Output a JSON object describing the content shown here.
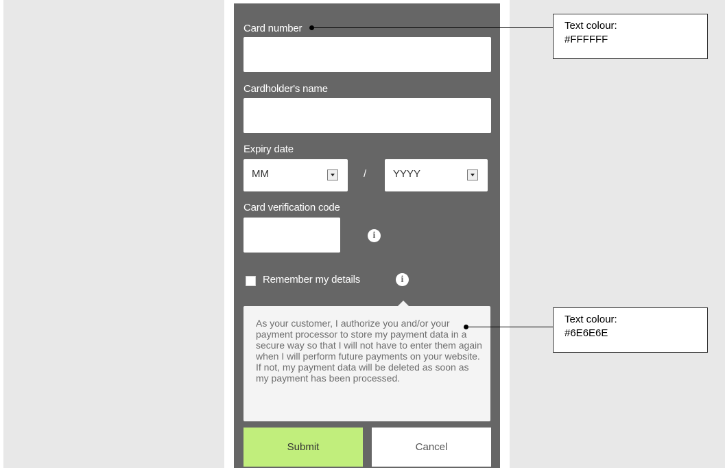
{
  "form": {
    "card_number_label": "Card number",
    "cardholder_label": "Cardholder's name",
    "expiry_label": "Expiry date",
    "month_value": "MM",
    "year_value": "YYYY",
    "slash": "/",
    "cvc_label": "Card verification code",
    "remember_label": "Remember my details",
    "info_glyph": "i",
    "tooltip_text": "As your customer, I authorize you and/or your payment processor to store my payment data in a secure way so that I will not have to enter them again when I will perform future payments on your website. If not, my payment data will be deleted as soon as my payment has been processed.",
    "submit_label": "Submit",
    "cancel_label": "Cancel"
  },
  "annotations": {
    "callout_1_title": "Text colour:",
    "callout_1_value": "#FFFFFF",
    "callout_2_title": "Text colour:",
    "callout_2_value": "#6E6E6E"
  },
  "colors": {
    "panel_background": "#666666",
    "label_text": "#FFFFFF",
    "tooltip_text": "#6E6E6E",
    "submit_background": "#C1EE7C",
    "page_background": "#E8E8E8"
  },
  "icons": [
    "info-icon",
    "dropdown-arrow-icon",
    "checkbox"
  ]
}
